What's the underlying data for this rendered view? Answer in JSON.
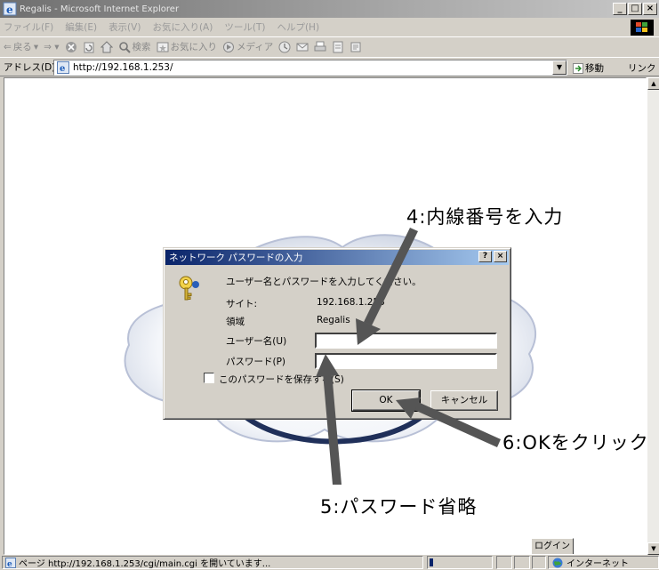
{
  "window": {
    "title": "Regalis - Microsoft Internet Explorer",
    "buttons": [
      "_",
      "□",
      "×"
    ]
  },
  "menu": [
    "ファイル(F)",
    "編集(E)",
    "表示(V)",
    "お気に入り(A)",
    "ツール(T)",
    "ヘルプ(H)"
  ],
  "toolbar": {
    "back": "戻る",
    "search": "検索",
    "favorites": "お気に入り",
    "media": "メディア"
  },
  "address": {
    "label": "アドレス(D)",
    "url": "http://192.168.1.253/",
    "go": "移動",
    "links": "リンク »"
  },
  "page": {
    "login_button": "ログイン"
  },
  "dialog": {
    "title": "ネットワーク パスワードの入力",
    "help_btn": "?",
    "close_btn": "×",
    "prompt": "ユーザー名とパスワードを入力してください。",
    "site_label": "サイト:",
    "site_value": "192.168.1.253",
    "realm_label": "領域",
    "realm_value": "Regalis",
    "username_label": "ユーザー名(U)",
    "username_value": "",
    "password_label": "パスワード(P)",
    "password_value": "",
    "save_password_label": "このパスワードを保存する(S)",
    "save_password_checked": false,
    "ok_label": "OK",
    "cancel_label": "キャンセル"
  },
  "annotations": {
    "step4": "4:内線番号を入力",
    "step5": "5:パスワード省略",
    "step6": "6:OKをクリック"
  },
  "status": {
    "text": "ページ http://192.168.1.253/cgi/main.cgi を開いています...",
    "zone": "インターネット"
  },
  "colors": {
    "dialog_title_start": "#0a246a",
    "dialog_title_end": "#a6caf0",
    "annotation_arrow": "#555555",
    "window_face": "#d4d0c8"
  }
}
